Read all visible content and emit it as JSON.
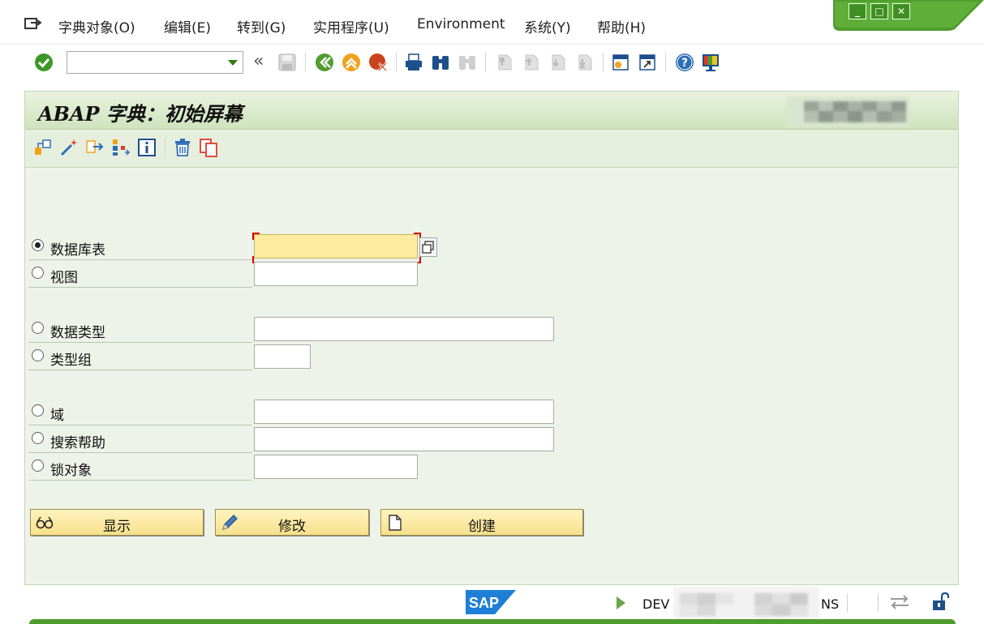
{
  "menubar": {
    "items": [
      {
        "label": "字典对象(O)"
      },
      {
        "label": "编辑(E)"
      },
      {
        "label": "转到(G)"
      },
      {
        "label": "实用程序(U)"
      },
      {
        "label": "Environment"
      },
      {
        "label": "系统(Y)"
      },
      {
        "label": "帮助(H)"
      }
    ]
  },
  "toolbar": {
    "command_value": "",
    "back_glyph": "«"
  },
  "page": {
    "title": "ABAP 字典：初始屏幕"
  },
  "form": {
    "rows": [
      {
        "label": "数据库表",
        "value": "",
        "selected": true
      },
      {
        "label": "视图",
        "value": "",
        "selected": false
      },
      {
        "label": "数据类型",
        "value": "",
        "selected": false
      },
      {
        "label": "类型组",
        "value": "",
        "selected": false
      },
      {
        "label": "域",
        "value": "",
        "selected": false
      },
      {
        "label": "搜索帮助",
        "value": "",
        "selected": false
      },
      {
        "label": "锁对象",
        "value": "",
        "selected": false
      }
    ]
  },
  "buttons": {
    "display": "显示",
    "change": "修改",
    "create": "创建"
  },
  "status": {
    "system_prefix": "DEV",
    "system_suffix": "NS",
    "brand": "SAP"
  },
  "colors": {
    "accent_green": "#4f9d2d",
    "panel_bg": "#eef3e9",
    "focus_field": "#fdeb9f",
    "button_yellow": "#f8e08a"
  }
}
